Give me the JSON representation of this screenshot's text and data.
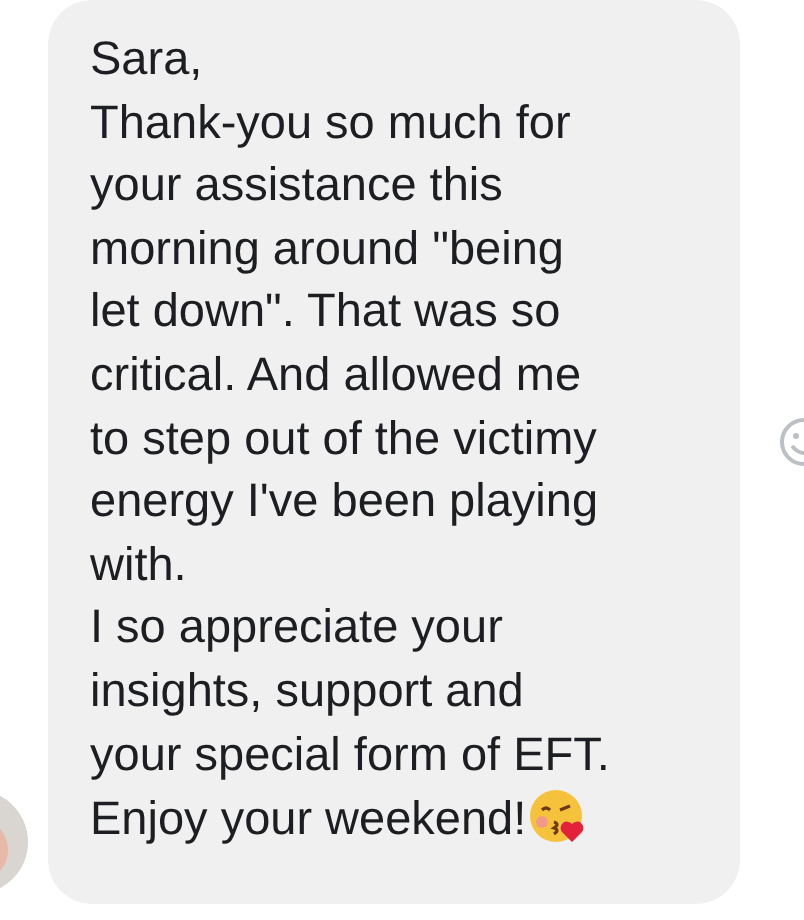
{
  "message": {
    "lines": [
      "Sara,",
      "Thank-you so much for",
      "your assistance this",
      "morning around \"being",
      "let down\". That was so",
      "critical. And allowed me",
      "to step out of the victimy",
      "energy I've been playing",
      "with.",
      "I so appreciate your",
      "insights, support and",
      "your special form of EFT.",
      "Enjoy your weekend!"
    ]
  }
}
